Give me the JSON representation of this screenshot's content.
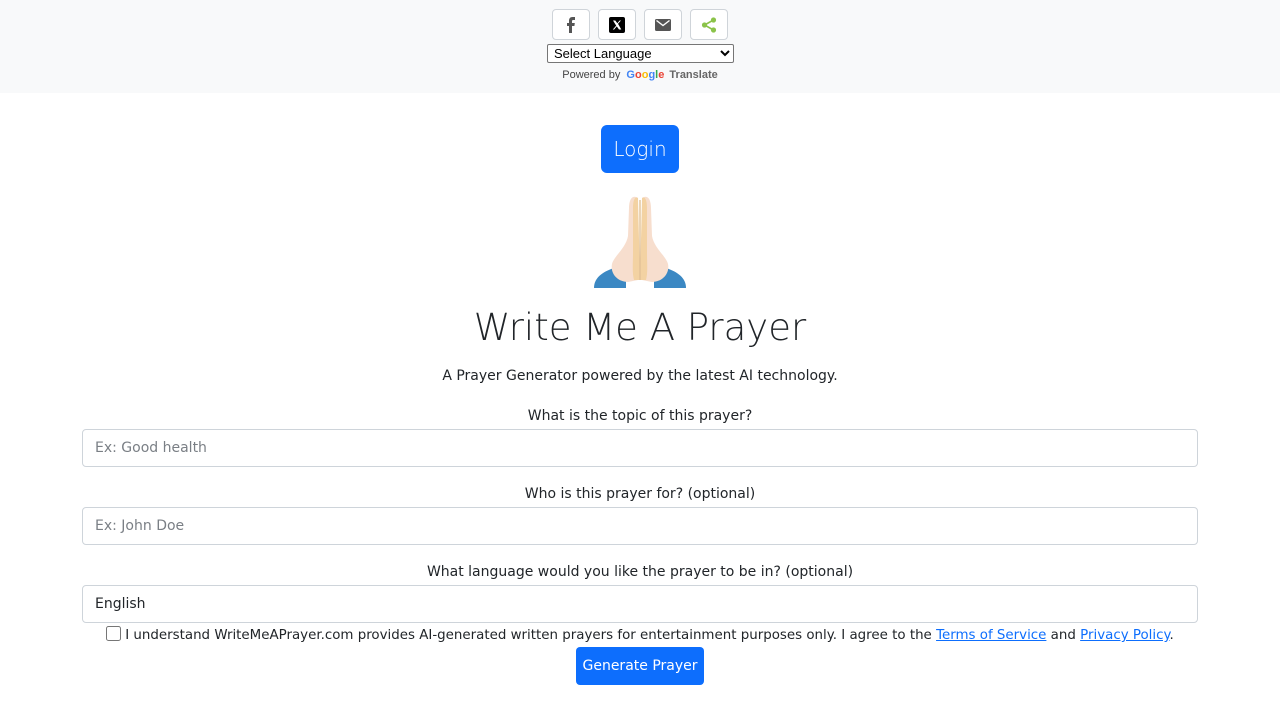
{
  "share": {
    "buttons": [
      {
        "icon": "facebook-icon",
        "color": "#555555"
      },
      {
        "icon": "x-twitter-icon",
        "color": "#000000"
      },
      {
        "icon": "email-icon",
        "color": "#555555"
      },
      {
        "icon": "sharethis-icon",
        "color": "#8bc34a"
      }
    ]
  },
  "translate": {
    "select_label": "Select Language",
    "powered_by": "Powered by",
    "google": "Google",
    "translate_word": "Translate"
  },
  "login": {
    "label": "Login"
  },
  "hero": {
    "icon": "praying-hands-icon"
  },
  "title": "Write Me A Prayer",
  "subtitle": "A Prayer Generator powered by the latest AI technology.",
  "form": {
    "topic": {
      "label": "What is the topic of this prayer?",
      "placeholder": "Ex: Good health"
    },
    "for_whom": {
      "label": "Who is this prayer for? (optional)",
      "placeholder": "Ex: John Doe"
    },
    "language": {
      "label": "What language would you like the prayer to be in? (optional)",
      "value": "English"
    },
    "agreement": {
      "text": "I understand WriteMeAPrayer.com provides AI-generated written prayers for entertainment purposes only. I agree to the",
      "tos_link": "Terms of Service",
      "and": "and",
      "privacy_link": "Privacy Policy",
      "period": "."
    },
    "submit_label": "Generate Prayer"
  },
  "colors": {
    "primary": "#0d6efd",
    "topbar_bg": "#f8f9fa"
  }
}
